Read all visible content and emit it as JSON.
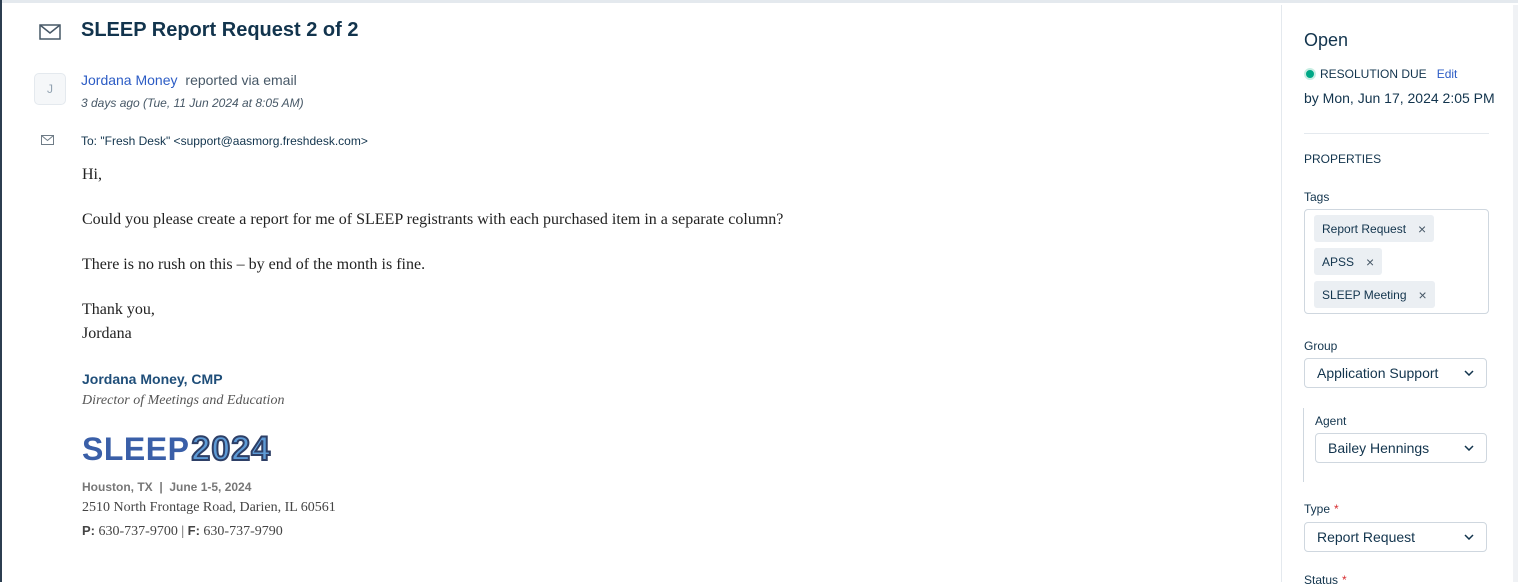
{
  "ticket": {
    "title": "SLEEP Report Request 2 of 2",
    "avatar_initial": "J",
    "reporter_name": "Jordana Money",
    "reporter_via": "reported via email",
    "timestamp": "3 days ago (Tue, 11 Jun 2024 at 8:05 AM)",
    "to_label": "To:",
    "to_value": "\"Fresh Desk\" <support@aasmorg.freshdesk.com>"
  },
  "email": {
    "greeting": "Hi,",
    "para1": "Could you please create a report for me of SLEEP registrants with each purchased item in a separate column?",
    "para2": "There is no rush on this – by end of the month is fine.",
    "closing": "Thank you,",
    "closing_name": "Jordana"
  },
  "signature": {
    "name": "Jordana Money, CMP",
    "title": "Director of Meetings and Education",
    "logo_word": "SLEEP",
    "logo_year": "2024",
    "location": "Houston, TX  |  June 1-5, 2024",
    "address": "2510 North Frontage Road, Darien, IL 60561",
    "phone_label": "P:",
    "phone": "630-737-9700",
    "fax_label": "F:",
    "fax": "630-737-9790"
  },
  "sidebar": {
    "status": "Open",
    "resolution_due_label": "RESOLUTION DUE",
    "edit_label": "Edit",
    "due_date": "by Mon, Jun 17, 2024 2:05 PM",
    "properties_heading": "PROPERTIES",
    "tags_label": "Tags",
    "tags": [
      "Report Request",
      "APSS",
      "SLEEP Meeting"
    ],
    "tag_remove_glyph": "×",
    "group_label": "Group",
    "group_value": "Application Support",
    "agent_label": "Agent",
    "agent_value": "Bailey Hennings",
    "type_label": "Type",
    "type_value": "Report Request",
    "status_label": "Status",
    "required_mark": "*"
  },
  "colors": {
    "link": "#2c5cc5",
    "resolution_dot": "#00a886",
    "required": "#d72d30"
  }
}
